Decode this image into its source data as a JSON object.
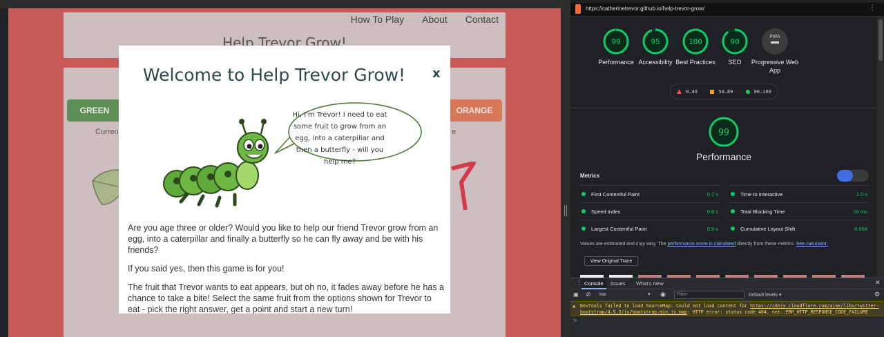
{
  "game": {
    "nav": [
      "How To Play",
      "About",
      "Contact"
    ],
    "header_title": "Help Trevor Grow!",
    "buttons": {
      "green": "GREEN",
      "orange": "ORANGE"
    },
    "partial_left": "Curren",
    "partial_right": "e",
    "modal": {
      "title": "Welcome to Help Trevor Grow!",
      "close": "x",
      "speech": "Hi, I'm Trevor! I need to eat some fruit to grow from an egg, into a caterpillar and then a butterfly - will you help me?",
      "p1": "Are you age three or older? Would you like to help our friend Trevor grow from an egg, into a caterpillar and finally a butterfly so he can fly away and be with his friends?",
      "p2": "If you said yes, then this game is for you!",
      "p3": "The fruit that Trevor wants to eat appears, but oh no, it fades away before he has a chance to take a bite! Select the same fruit from the options shown for Trevor to eat - pick the right answer, get a point and start a new turn!"
    }
  },
  "devtools": {
    "url": "https://catherinetrevor.github.io/help-trevor-grow/",
    "gauges": [
      {
        "score": "99",
        "label": "Performance",
        "value": 99
      },
      {
        "score": "95",
        "label": "Accessibility",
        "value": 95
      },
      {
        "score": "100",
        "label": "Best Practices",
        "value": 100
      },
      {
        "score": "90",
        "label": "SEO",
        "value": 90
      },
      {
        "score": "PWA",
        "label": "Progressive Web App"
      }
    ],
    "legend": {
      "fail": "0–49",
      "average": "50–89",
      "pass": "90–100"
    },
    "main_score": "99",
    "main_title": "Performance",
    "metrics_label": "Metrics",
    "metrics": [
      {
        "name": "First Contentful Paint",
        "value": "0.7 s"
      },
      {
        "name": "Time to Interactive",
        "value": "1.0 s"
      },
      {
        "name": "Speed Index",
        "value": "0.8 s"
      },
      {
        "name": "Total Blocking Time",
        "value": "10 ms"
      },
      {
        "name": "Largest Contentful Paint",
        "value": "0.9 s"
      },
      {
        "name": "Cumulative Layout Shift",
        "value": "0.004"
      }
    ],
    "note": {
      "a": "Values are estimated and may vary. The ",
      "link1": "performance score is calculated",
      "b": " directly from these metrics. ",
      "link2": "See calculator."
    },
    "view_trace": "View Original Trace",
    "console": {
      "tabs": [
        "Console",
        "Issues",
        "What's New"
      ],
      "context": "top",
      "filter_placeholder": "Filter",
      "levels": "Default levels ▾",
      "warn_a": "DevTools failed to load SourceMap: Could not load content for ",
      "warn_link": "https://cdnjs.cloudflare.com/ajax/libs/twitter-bootstrap/4.5.2/js/bootstrap.min.js.map",
      "warn_b": ": HTTP error: status code 404, net::ERR_HTTP_RESPONSE_CODE_FAILURE",
      "prompt": ">"
    },
    "colors": {
      "pass": "#0cce6b",
      "average": "#ffa400",
      "fail": "#ff4e42",
      "link": "#8ab4f8"
    }
  }
}
